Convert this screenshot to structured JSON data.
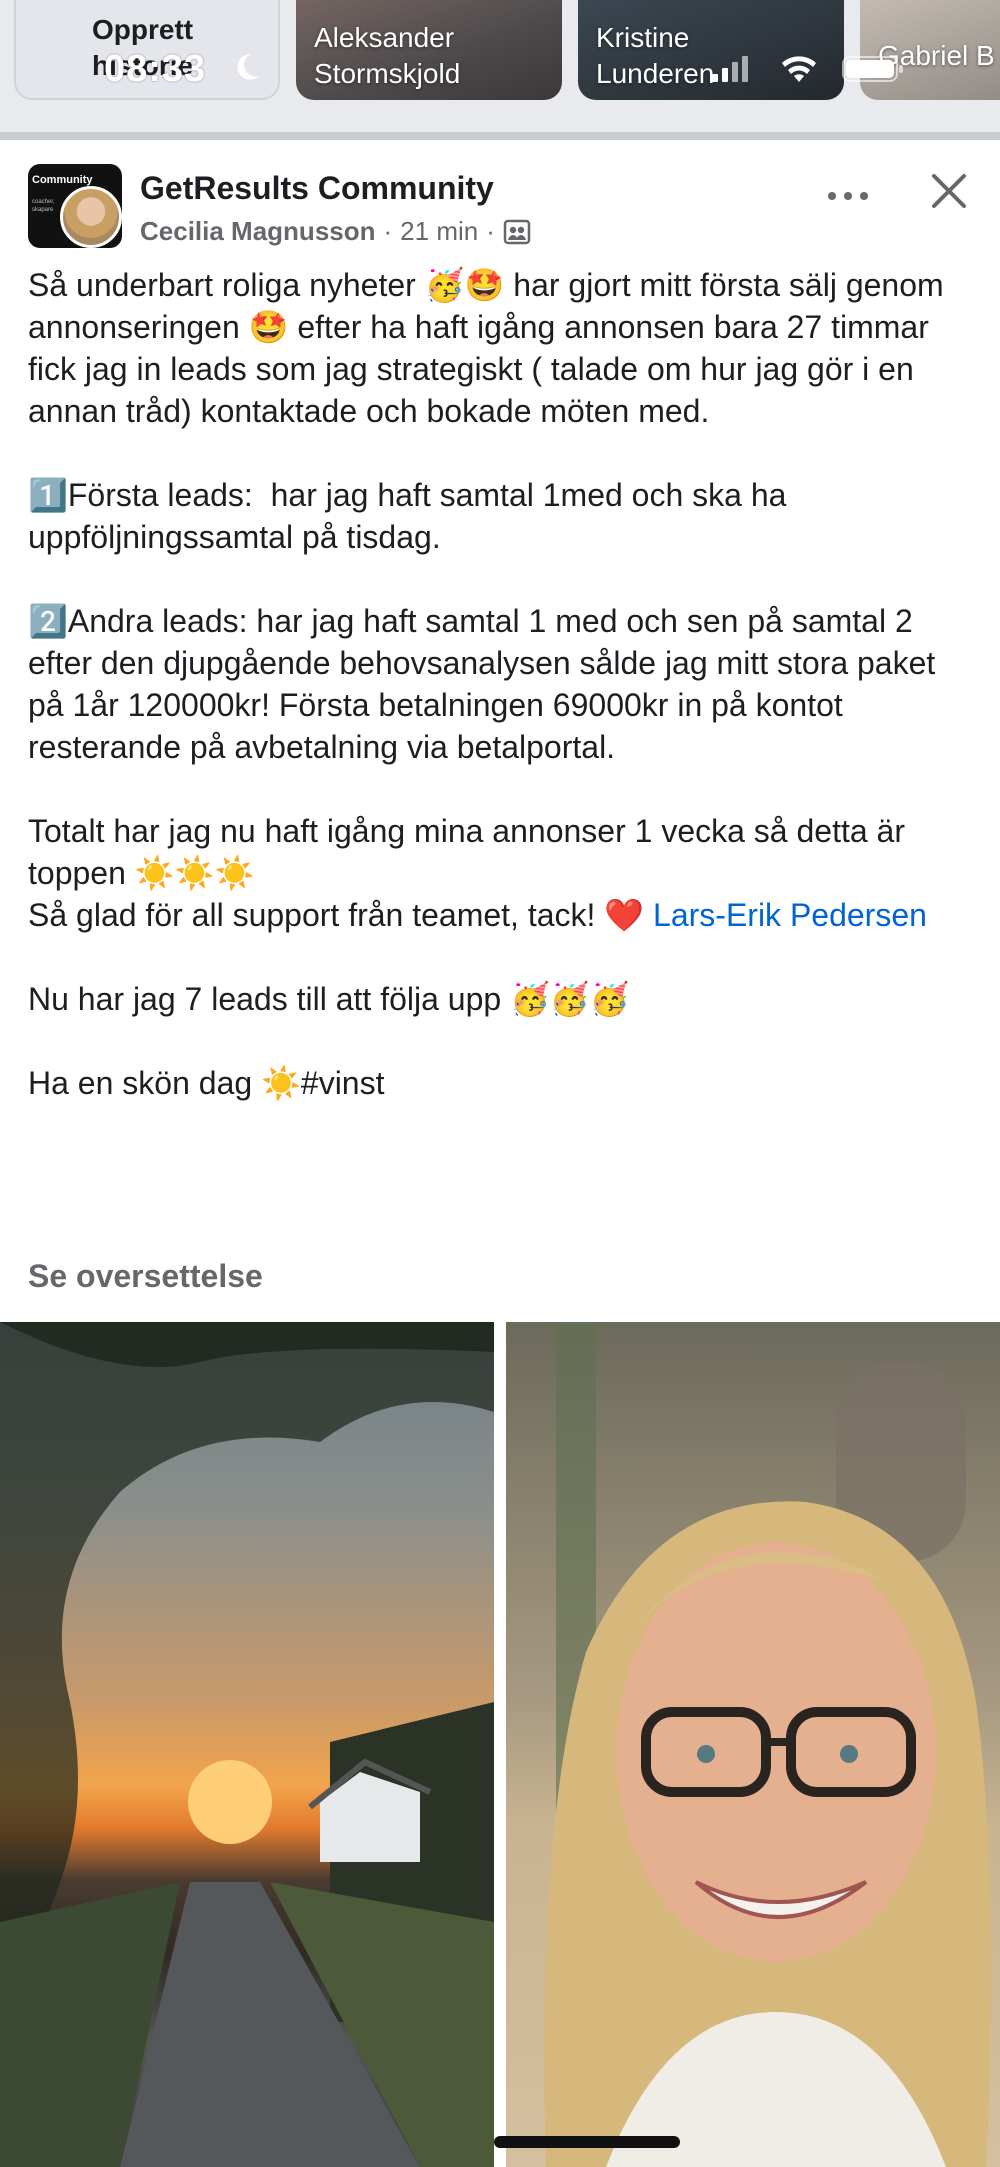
{
  "status_bar": {
    "time": "08:33"
  },
  "stories": {
    "create_label": "Opprett\nhistorie",
    "items": [
      {
        "name": "Aleksander\nStormskjold"
      },
      {
        "name": "Kristine\nLunderen"
      },
      {
        "name": "Gabriel B"
      }
    ]
  },
  "post": {
    "group_name": "GetResults Community",
    "author": "Cecilia Magnusson",
    "time": "21 min",
    "body_paragraphs": [
      "Så underbart roliga nyheter 🥳🤩 har gjort mitt första sälj genom annonseringen 🤩 efter ha haft igång annonsen bara 27 timmar fick jag in leads som jag strategiskt ( talade om hur jag gör i en annan tråd) kontaktade och bokade möten med.",
      "1️⃣Första leads:  har jag haft samtal 1med och ska ha uppföljningssamtal på tisdag.",
      "2️⃣Andra leads: har jag haft samtal 1 med och sen på samtal 2 efter den djupgående behovsanalysen sålde jag mitt stora paket på 1år 120000kr! Första betalningen 69000kr in på kontot resterande på avbetalning via betalportal."
    ],
    "body_total": "Totalt har jag nu haft igång mina annonser 1 vecka så detta är toppen ☀️☀️☀️",
    "body_thanks": "Så glad för all support från teamet, tack! ❤️ ",
    "mention": "Lars-Erik Pedersen",
    "body_leads": "Nu har jag 7 leads till att följa upp 🥳🥳🥳",
    "body_closing": "Ha en skön dag ☀️#vinst",
    "translate_label": "Se oversettelse"
  },
  "colors": {
    "link": "#0064d1",
    "meta": "#65676b",
    "text": "#1c1e21"
  },
  "icons": [
    "moon-icon",
    "signal-icon",
    "wifi-icon",
    "battery-icon",
    "more-icon",
    "close-icon",
    "group-icon"
  ]
}
